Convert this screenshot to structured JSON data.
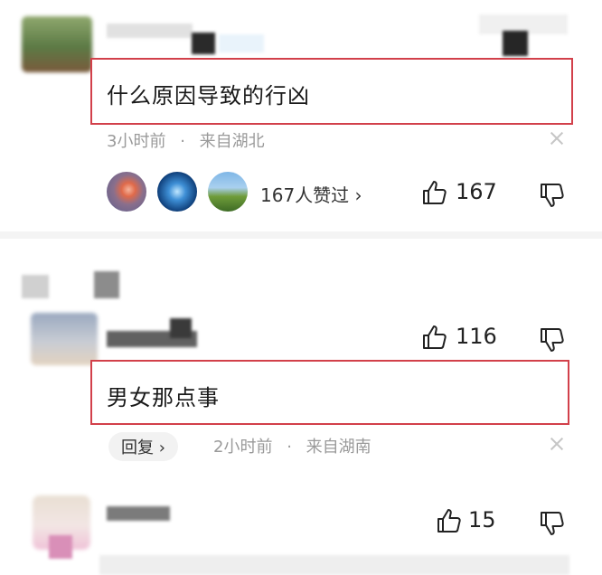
{
  "comments": [
    {
      "text": "什么原因导致的行凶",
      "time": "3小时前",
      "location": "来自湖北",
      "likers_text": "167人赞过 ›",
      "like_count": "167"
    },
    {
      "text": "男女那点事",
      "reply_label": "回复 ›",
      "time": "2小时前",
      "location": "来自湖南",
      "like_count": "116"
    },
    {
      "like_count": "15"
    }
  ],
  "separator": "·",
  "colors": {
    "highlight_border": "#d2404a",
    "meta_text": "#9a9a9a",
    "divider": "#f4f4f4"
  },
  "icons": [
    "like-icon",
    "dislike-icon",
    "close-icon"
  ]
}
